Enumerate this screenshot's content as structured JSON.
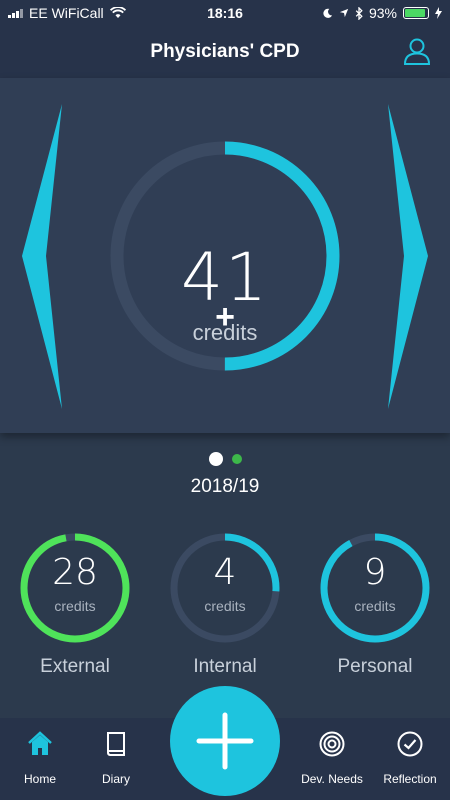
{
  "status_bar": {
    "carrier": "EE WiFiCall",
    "time": "18:16",
    "battery": "93%",
    "battery_level": 0.93
  },
  "header": {
    "title": "Physicians' CPD"
  },
  "hero": {
    "total_credits": "41",
    "credits_label": "credits",
    "add_symbol": "+",
    "progress": 0.5,
    "accent": "#1ec4de",
    "track": "#3b4a62"
  },
  "pager": {
    "active_index": 0,
    "count": 2
  },
  "year": "2018/19",
  "categories": [
    {
      "value": "28",
      "unit": "credits",
      "label": "External",
      "progress": 0.97,
      "color": "#4fe35a"
    },
    {
      "value": "4",
      "unit": "credits",
      "label": "Internal",
      "progress": 0.26,
      "color": "#1ec4de"
    },
    {
      "value": "9",
      "unit": "credits",
      "label": "Personal",
      "progress": 0.92,
      "color": "#1ec4de"
    }
  ],
  "nav": {
    "home": "Home",
    "diary": "Diary",
    "dev_needs": "Dev. Needs",
    "reflection": "Reflection",
    "active": "home"
  }
}
